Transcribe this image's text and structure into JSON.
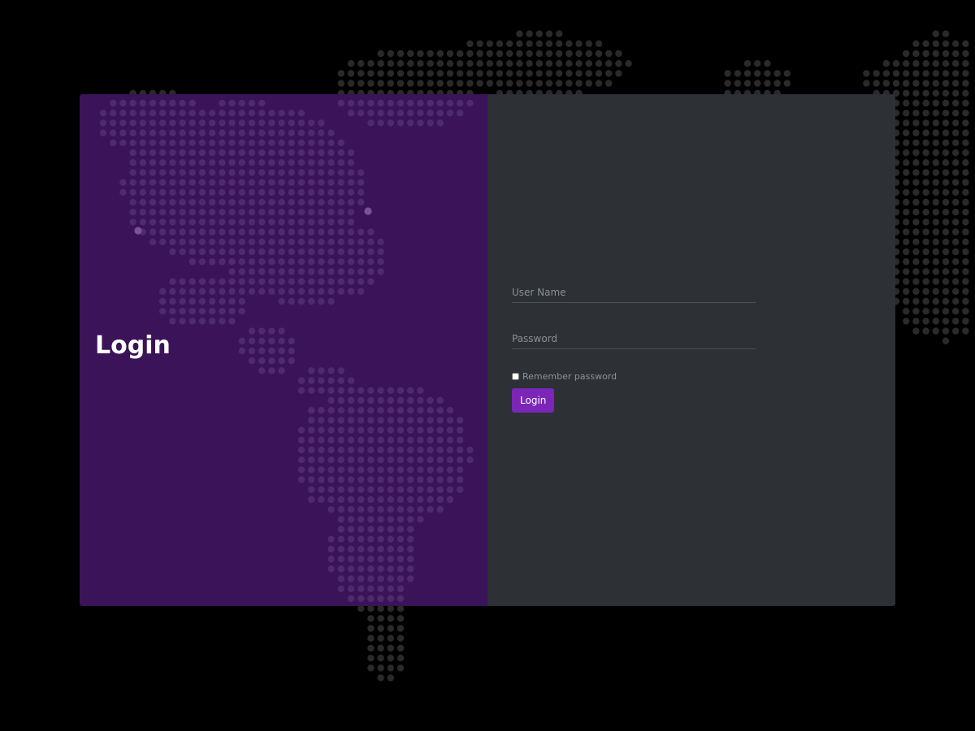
{
  "login_panel": {
    "title": "Login"
  },
  "form": {
    "username_placeholder": "User Name",
    "password_placeholder": "Password",
    "remember_label": "Remember password",
    "submit_label": "Login"
  },
  "colors": {
    "page_background": "#000000",
    "left_panel": "#3a1358",
    "right_panel": "#2d3034",
    "accent": "#7b26b7",
    "map_dots": "#2a2a2a",
    "panel_map_dots": "#4e2a6e"
  }
}
